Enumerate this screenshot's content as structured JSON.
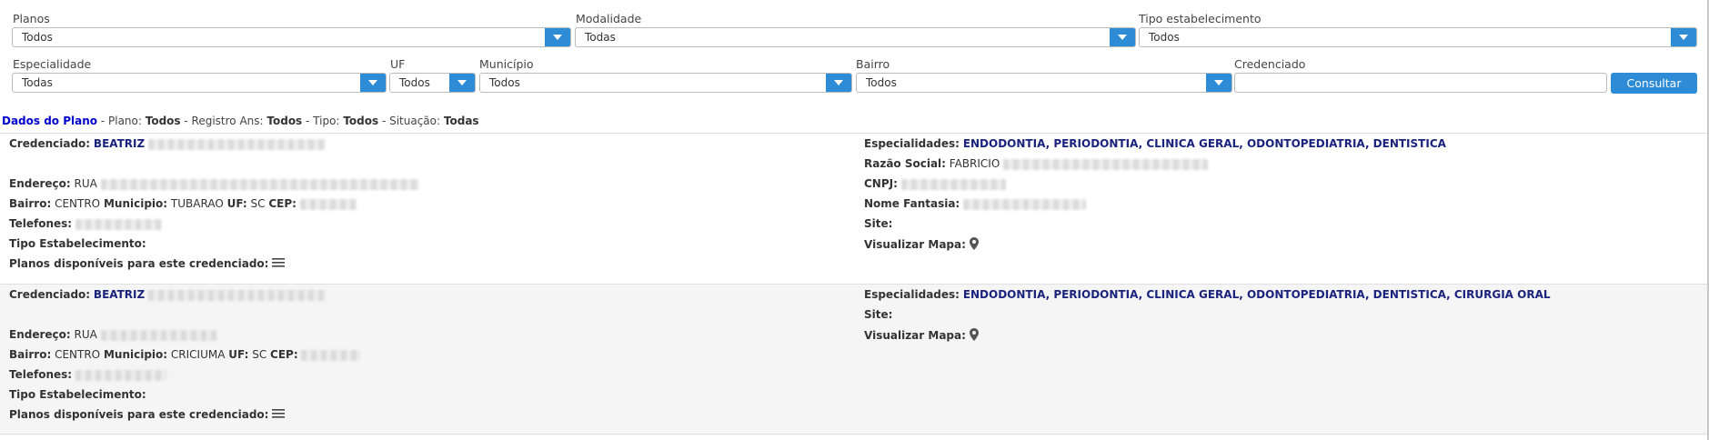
{
  "filters": {
    "planos": {
      "label": "Planos",
      "value": "Todos"
    },
    "modalidade": {
      "label": "Modalidade",
      "value": "Todas"
    },
    "tipo_estabelecimento": {
      "label": "Tipo estabelecimento",
      "value": "Todos"
    },
    "especialidade": {
      "label": "Especialidade",
      "value": "Todas"
    },
    "uf": {
      "label": "UF",
      "value": "Todos"
    },
    "municipio": {
      "label": "Município",
      "value": "Todos"
    },
    "bairro": {
      "label": "Bairro",
      "value": "Todos"
    },
    "credenciado": {
      "label": "Credenciado",
      "value": ""
    },
    "consultar_label": "Consultar"
  },
  "summary": {
    "title": "Dados do Plano",
    "plano_label": "- Plano:",
    "plano_value": "Todos",
    "registro_label": "- Registro Ans:",
    "registro_value": "Todos",
    "tipo_label": "- Tipo:",
    "tipo_value": "Todos",
    "situacao_label": "- Situação:",
    "situacao_value": "Todas"
  },
  "labels": {
    "credenciado": "Credenciado:",
    "endereco": "Endereço:",
    "bairro": "Bairro:",
    "municipio": "Municipio:",
    "uf": "UF:",
    "cep": "CEP:",
    "telefones": "Telefones:",
    "tipo_estabelecimento": "Tipo Estabelecimento:",
    "planos_disponiveis": "Planos disponíveis para este credenciado:",
    "especialidades": "Especialidades:",
    "razao_social": "Razão Social:",
    "cnpj": "CNPJ:",
    "nome_fantasia": "Nome Fantasia:",
    "site": "Site:",
    "visualizar_mapa": "Visualizar Mapa:"
  },
  "results": [
    {
      "credenciado": "BEATRIZ",
      "endereco": "RUA",
      "bairro": "CENTRO",
      "municipio": "TUBARAO",
      "uf": "SC",
      "especialidades": "ENDODONTIA, PERIODONTIA, CLINICA GERAL, ODONTOPEDIATRIA, DENTISTICA",
      "razao_social": "FABRICIO",
      "icons": {
        "list": "list-icon",
        "map": "map-pin-icon"
      }
    },
    {
      "credenciado": "BEATRIZ",
      "endereco": "RUA",
      "bairro": "CENTRO",
      "municipio": "CRICIUMA",
      "uf": "SC",
      "especialidades": "ENDODONTIA, PERIODONTIA, CLINICA GERAL, ODONTOPEDIATRIA, DENTISTICA, CIRURGIA ORAL",
      "icons": {
        "list": "list-icon",
        "map": "map-pin-icon"
      }
    }
  ],
  "colors": {
    "accent": "#2e8bd6",
    "name": "#1a237e",
    "title": "#0000cc",
    "alt_row": "#f5f5f5"
  }
}
